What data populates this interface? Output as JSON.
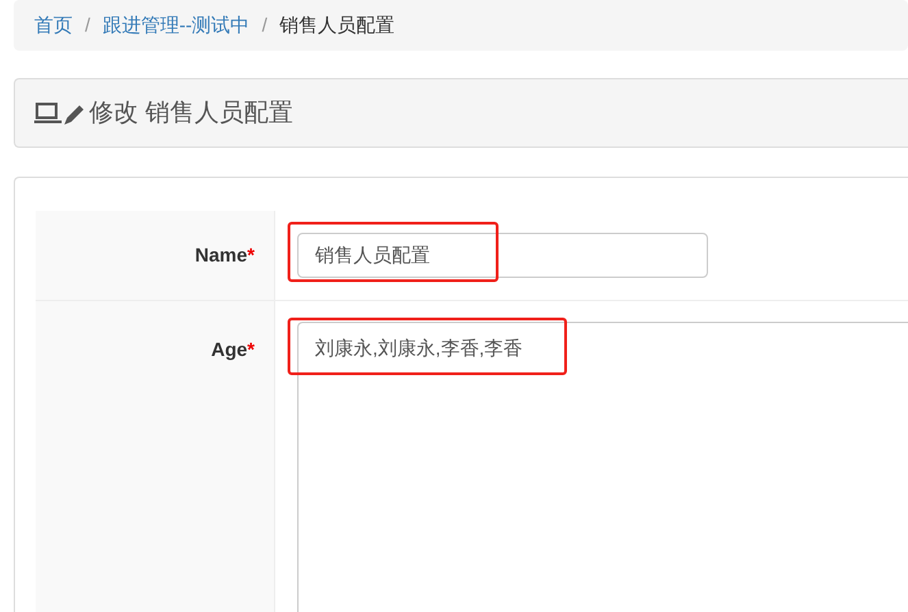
{
  "breadcrumb": [
    {
      "label": "首页",
      "active": false
    },
    {
      "separator": "/",
      "label": "跟进管理--测试中",
      "active": false
    },
    {
      "separator": "/",
      "label": "销售人员配置",
      "active": true
    }
  ],
  "heading": {
    "action": "修改",
    "title": "销售人员配置"
  },
  "form": {
    "fields": [
      {
        "label": "Name",
        "required": "*",
        "kind": "input",
        "value": "销售人员配置",
        "highlighted": true
      },
      {
        "label": "Age",
        "required": "*",
        "kind": "textarea",
        "value": "刘康永,刘康永,李香,李香",
        "highlighted": true
      }
    ]
  }
}
